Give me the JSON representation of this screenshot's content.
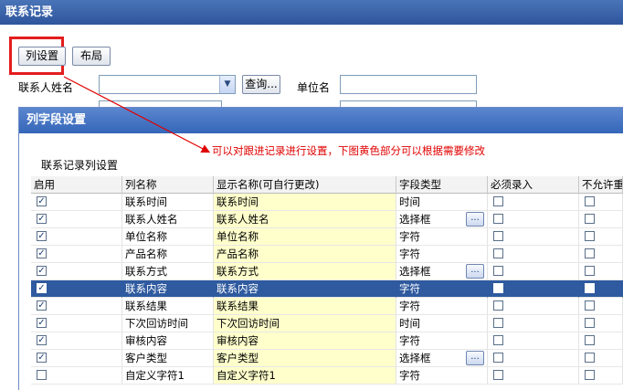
{
  "window": {
    "title": "联系记录"
  },
  "toolbar": {
    "column_settings_label": "列设置",
    "layout_label": "布局"
  },
  "filters": {
    "contact_name_label": "联系人姓名",
    "contact_name_value": "",
    "query_label": "查询...",
    "company_label": "单位名",
    "company_value": ""
  },
  "dialog": {
    "title": "列字段设置",
    "section_label": "联系记录列设置",
    "note": "可以对跟进记录进行设置，下图黄色部分可以根据需要修改",
    "columns": [
      "启用",
      "列名称",
      "显示名称(可自行更改)",
      "字段类型",
      "必须录入",
      "不允许重复"
    ],
    "rows": [
      {
        "enabled": "✓",
        "name": "联系时间",
        "display": "联系时间",
        "type": "时间",
        "ellipsis": false,
        "required": "",
        "unique": ""
      },
      {
        "enabled": "✓",
        "name": "联系人姓名",
        "display": "联系人姓名",
        "type": "选择框",
        "ellipsis": true,
        "required": "",
        "unique": ""
      },
      {
        "enabled": "✓",
        "name": "单位名称",
        "display": "单位名称",
        "type": "字符",
        "ellipsis": false,
        "required": "",
        "unique": ""
      },
      {
        "enabled": "✓",
        "name": "产品名称",
        "display": "产品名称",
        "type": "字符",
        "ellipsis": false,
        "required": "",
        "unique": ""
      },
      {
        "enabled": "✓",
        "name": "联系方式",
        "display": "联系方式",
        "type": "选择框",
        "ellipsis": true,
        "required": "",
        "unique": ""
      },
      {
        "enabled": "✓",
        "name": "联系内容",
        "display": "联系内容",
        "type": "字符",
        "ellipsis": false,
        "required": "",
        "unique": "",
        "selected": true
      },
      {
        "enabled": "✓",
        "name": "联系结果",
        "display": "联系结果",
        "type": "字符",
        "ellipsis": false,
        "required": "",
        "unique": ""
      },
      {
        "enabled": "✓",
        "name": "下次回访时间",
        "display": "下次回访时间",
        "type": "时间",
        "ellipsis": false,
        "required": "",
        "unique": ""
      },
      {
        "enabled": "✓",
        "name": "审核内容",
        "display": "审核内容",
        "type": "字符",
        "ellipsis": false,
        "required": "",
        "unique": ""
      },
      {
        "enabled": "✓",
        "name": "客户类型",
        "display": "客户类型",
        "type": "选择框",
        "ellipsis": true,
        "required": "",
        "unique": ""
      },
      {
        "enabled": "",
        "name": "自定义字符1",
        "display": "自定义字符1",
        "type": "字符",
        "ellipsis": false,
        "required": "",
        "unique": ""
      }
    ]
  },
  "colors": {
    "title_bar": "#2e559c",
    "highlight_box": "#e41d1d",
    "editable_cell": "#ffffcc",
    "selected_row": "#2f5a9f",
    "note_text": "#e00000"
  },
  "icons": {
    "combo_arrow": "chevron-down-icon",
    "ellipsis": "ellipsis-icon"
  }
}
